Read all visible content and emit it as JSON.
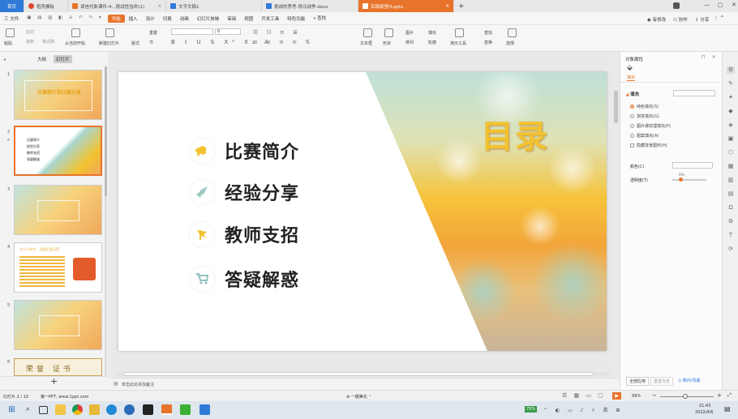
{
  "tabs": [
    {
      "label": "首页",
      "color": "#2f7ad6",
      "active_home": true
    },
    {
      "label": "稻壳模板",
      "color": "#e0452d"
    },
    {
      "label": "读信代新课件-4...挑战性验命(1)",
      "color": "#e8742b"
    },
    {
      "label": "文字文稿1",
      "color": "#2f7ad6"
    },
    {
      "label": "挑战的思考-场马战争.docx",
      "color": "#2f7ad6"
    },
    {
      "label": "实践部室H.pptx",
      "color": "#e8742b",
      "active": true
    }
  ],
  "menubar": {
    "file": "三 文件",
    "items": [
      "开始",
      "插入",
      "设计",
      "切换",
      "动画",
      "幻灯片放映",
      "审阅",
      "视图",
      "开发工具",
      "特色功能",
      "查找"
    ],
    "active": "开始",
    "right": [
      "有修改",
      "协作",
      "分享"
    ]
  },
  "ribbon": {
    "groups": [
      "粘贴",
      "剪切",
      "复制",
      "格式刷",
      "从当前开始",
      "新建幻灯片",
      "版式",
      "节",
      "重置",
      "文本框",
      "形状",
      "排列",
      "轮廓",
      "演示工具",
      "替换",
      "选择",
      "图片",
      "填充",
      "查找"
    ],
    "font_size": "0",
    "font_name": ""
  },
  "panel": {
    "tabs": [
      "大纲",
      "幻灯片"
    ],
    "active_tab": "幻灯片",
    "slide_numbers": [
      "1",
      "2",
      "3",
      "4",
      "5",
      "6"
    ],
    "thumb1_title": "比赛简介和比赛分享",
    "thumb2_items": [
      "比赛简介",
      "经验分享",
      "教师支招",
      "答疑解惑"
    ],
    "thumb4_title": "七十十年中... 全国七届示范",
    "thumb6_text": "荣誉 证书",
    "add_slide": "+"
  },
  "slide": {
    "title": "目录",
    "items": [
      {
        "label": "比赛简介",
        "icon": "megaphone-icon"
      },
      {
        "label": "经验分享",
        "icon": "rocket-icon"
      },
      {
        "label": "教师支招",
        "icon": "flag-icon"
      },
      {
        "label": "答疑解惑",
        "icon": "cart-icon"
      }
    ],
    "notes_placeholder": "单击此处添加备注"
  },
  "rightpane": {
    "title": "对象属性",
    "tab": "填充",
    "section": "填充",
    "options": [
      "纯色填充(S)",
      "渐变填充(G)",
      "图片或纹理填充(P)",
      "图案填充(A)",
      "隐藏背景图形(H)"
    ],
    "selected_option": "纯色填充(S)",
    "color_label": "颜色(C)",
    "transparency_label": "透明度(T)",
    "transparency_value": "0%",
    "apply_all": "全部应用",
    "reset_bg": "重置背景",
    "link": "稿内/母版"
  },
  "statusbar": {
    "slide_info": "幻灯片 2 / 10",
    "theme": "第一PPT, www.1ppt.com",
    "beautify": "一键美化",
    "zoom": "99%"
  },
  "taskbar": {
    "time": "21:43",
    "date": "2022/4/6",
    "battery": "75%"
  },
  "colors": {
    "accent": "#e8742b",
    "gold": "#f2c230"
  }
}
